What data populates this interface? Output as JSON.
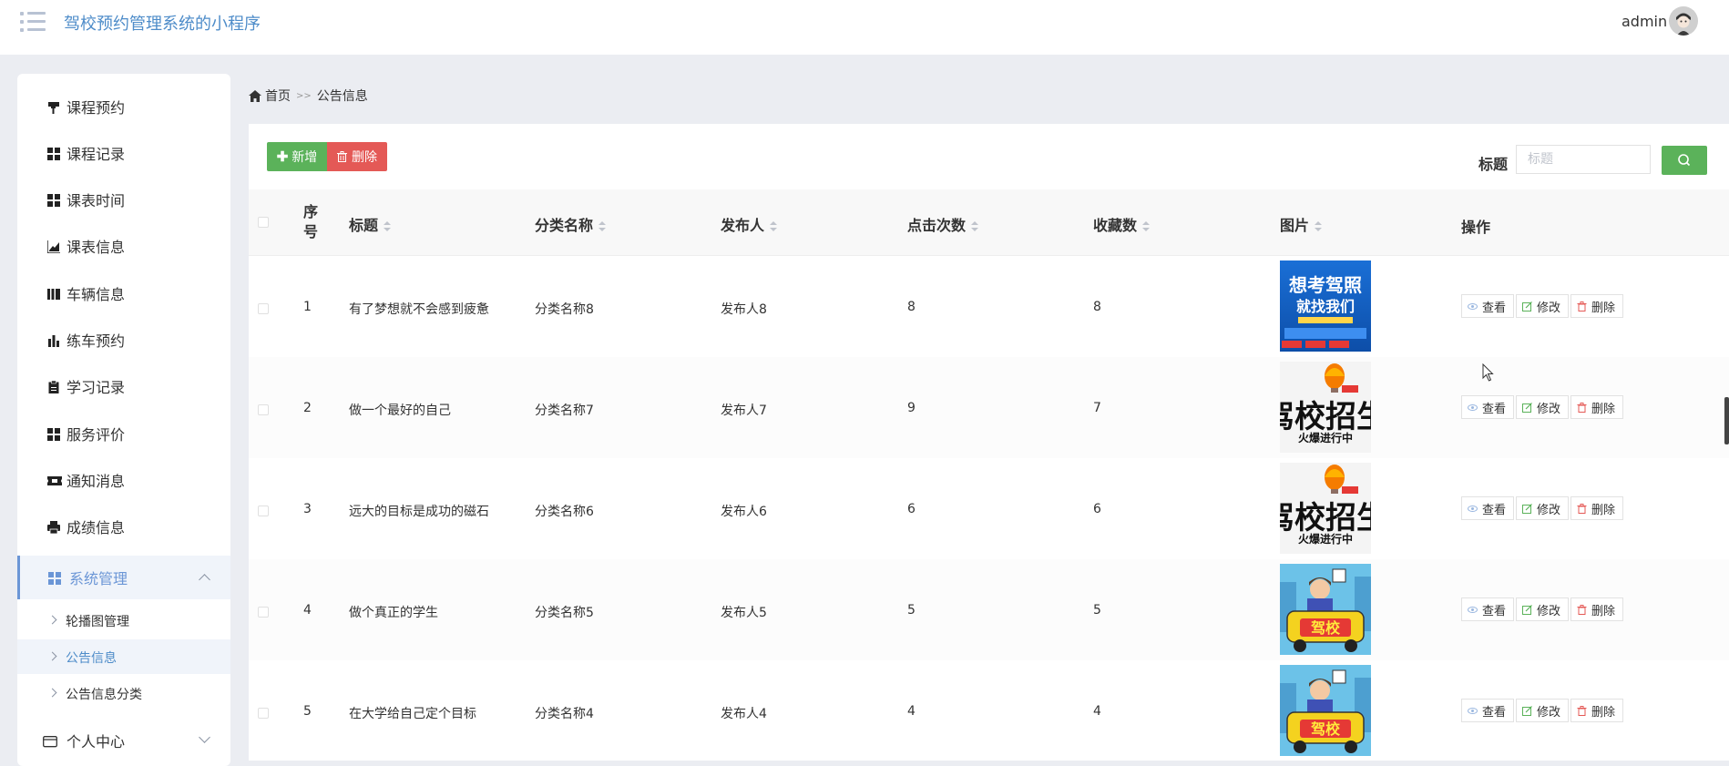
{
  "header": {
    "app_title": "驾校预约管理系统的小程序",
    "user_name": "admin"
  },
  "sidebar": {
    "items": [
      {
        "label": "课程预约",
        "icon": "brush-icon"
      },
      {
        "label": "课程记录",
        "icon": "grid-icon"
      },
      {
        "label": "课表时间",
        "icon": "grid-icon"
      },
      {
        "label": "课表信息",
        "icon": "line-chart-icon"
      },
      {
        "label": "车辆信息",
        "icon": "columns-icon"
      },
      {
        "label": "练车预约",
        "icon": "bar-chart-icon"
      },
      {
        "label": "学习记录",
        "icon": "clipboard-icon"
      },
      {
        "label": "服务评价",
        "icon": "grid-icon"
      },
      {
        "label": "通知消息",
        "icon": "ticket-icon"
      },
      {
        "label": "成绩信息",
        "icon": "printer-icon"
      }
    ],
    "system_group": {
      "label": "系统管理",
      "icon": "grid-icon",
      "children": [
        {
          "label": "轮播图管理"
        },
        {
          "label": "公告信息"
        },
        {
          "label": "公告信息分类"
        }
      ]
    },
    "personal_center": {
      "label": "个人中心",
      "icon": "card-icon"
    }
  },
  "breadcrumb": {
    "home": "首页",
    "separator": ">>",
    "current": "公告信息"
  },
  "toolbar": {
    "add_label": "新增",
    "delete_label": "删除",
    "search_label": "标题",
    "search_placeholder": "标题",
    "search_value": ""
  },
  "table": {
    "columns": {
      "index": "序号",
      "title": "标题",
      "category": "分类名称",
      "publisher": "发布人",
      "clicks": "点击次数",
      "favorites": "收藏数",
      "image": "图片",
      "actions": "操作"
    },
    "rows": [
      {
        "index": "1",
        "title": "有了梦想就不会感到疲惫",
        "category": "分类名称8",
        "publisher": "发布人8",
        "clicks": "8",
        "favorites": "8",
        "image_text": [
          "想考驾照",
          "就找我们"
        ],
        "image_kind": "blue-poster"
      },
      {
        "index": "2",
        "title": "做一个最好的自己",
        "category": "分类名称7",
        "publisher": "发布人7",
        "clicks": "9",
        "favorites": "7",
        "image_text": [
          "驾校招生",
          "火爆进行中"
        ],
        "image_kind": "balloon-poster"
      },
      {
        "index": "3",
        "title": "远大的目标是成功的磁石",
        "category": "分类名称6",
        "publisher": "发布人6",
        "clicks": "6",
        "favorites": "6",
        "image_text": [
          "驾校招生",
          "火爆进行中"
        ],
        "image_kind": "balloon-poster"
      },
      {
        "index": "4",
        "title": "做个真正的学生",
        "category": "分类名称5",
        "publisher": "发布人5",
        "clicks": "5",
        "favorites": "5",
        "image_text": [
          "驾校"
        ],
        "image_kind": "cartoon-car"
      },
      {
        "index": "5",
        "title": "在大学给自己定个目标",
        "category": "分类名称4",
        "publisher": "发布人4",
        "clicks": "4",
        "favorites": "4",
        "image_text": [
          "驾校"
        ],
        "image_kind": "cartoon-car"
      }
    ],
    "row_actions": {
      "view": "查看",
      "edit": "修改",
      "delete": "删除"
    }
  },
  "colors": {
    "brand_blue": "#4e8cc9",
    "add_green": "#5bb25a",
    "delete_red": "#e45956",
    "page_bg": "#ebedf2"
  }
}
